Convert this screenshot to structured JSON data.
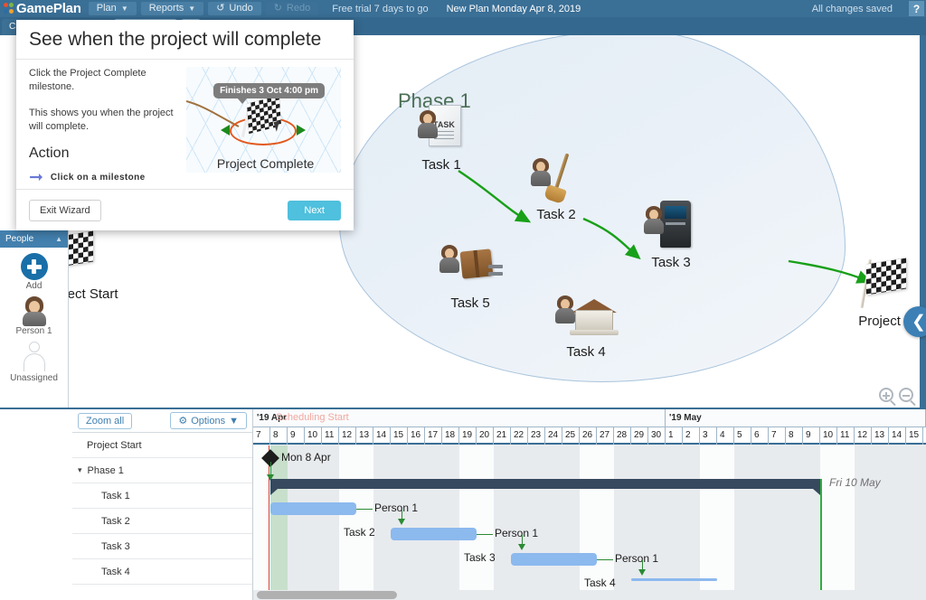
{
  "app": {
    "name": "GamePlan",
    "menus": [
      {
        "label": "Plan",
        "caret": "chevron-down-icon"
      },
      {
        "label": "Reports",
        "caret": "chevron-down-icon"
      }
    ],
    "undo_label": "Undo",
    "redo_label": "Redo",
    "trial_text": "Free trial 7 days to go",
    "plan_title": "New Plan Monday Apr 8, 2019",
    "save_status": "All changes saved",
    "help_label": "?"
  },
  "tabs": [
    {
      "label": "Cr"
    },
    {
      "label": ""
    },
    {
      "label": ""
    }
  ],
  "canvas": {
    "phase_label": "Phase 1",
    "project_start_label": "Project Start",
    "project_end_label": "Project End",
    "nodes": [
      {
        "label": "Task 1",
        "icon": "document-task-icon"
      },
      {
        "label": "Task 2",
        "icon": "broom-icon"
      },
      {
        "label": "Task 3",
        "icon": "kiosk-icon"
      },
      {
        "label": "Task 4",
        "icon": "house-icon"
      },
      {
        "label": "Task 5",
        "icon": "box-pallet-icon"
      }
    ],
    "zoom_in": "zoom-in-icon",
    "zoom_out": "zoom-out-icon",
    "nav_arrow": "chevron-left-icon"
  },
  "people": {
    "header": "People",
    "collapse": "triangle-up-icon",
    "items": [
      {
        "label": "Add",
        "icon": "plus-circle-icon"
      },
      {
        "label": "Person 1",
        "icon": "avatar-icon"
      },
      {
        "label": "Unassigned",
        "icon": "ghost-avatar-icon"
      }
    ]
  },
  "gantt": {
    "zoom_all_label": "Zoom all",
    "options_label": "Options",
    "options_icon": "gear-icon",
    "options_caret": "chevron-down-icon",
    "rows": [
      {
        "label": "Project Start",
        "indent": 0,
        "chevron": ""
      },
      {
        "label": "Phase 1",
        "indent": 0,
        "chevron": "chevron-down-icon"
      },
      {
        "label": "Task 1",
        "indent": 1,
        "chevron": ""
      },
      {
        "label": "Task 2",
        "indent": 1,
        "chevron": ""
      },
      {
        "label": "Task 3",
        "indent": 1,
        "chevron": ""
      },
      {
        "label": "Task 4",
        "indent": 1,
        "chevron": ""
      }
    ],
    "scheduling_start_label": "Scheduling Start",
    "months": [
      {
        "label": "'19  Apr",
        "start_day_index": 0,
        "span": 24
      },
      {
        "label": "'19  May",
        "start_day_index": 24,
        "span": 15
      }
    ],
    "days": [
      "7",
      "8",
      "9",
      "10",
      "11",
      "12",
      "13",
      "14",
      "15",
      "16",
      "17",
      "18",
      "19",
      "20",
      "21",
      "22",
      "23",
      "24",
      "25",
      "26",
      "27",
      "28",
      "29",
      "30",
      "1",
      "2",
      "3",
      "4",
      "5",
      "6",
      "7",
      "8",
      "9",
      "10",
      "11",
      "12",
      "13",
      "14",
      "15"
    ],
    "bars": [
      {
        "row": 0,
        "type": "milestone",
        "label": "Mon 8 Apr",
        "start_day_index": 1,
        "length_days": 0,
        "assignee": ""
      },
      {
        "row": 1,
        "type": "summary",
        "label": "Phase 1",
        "start_day_index": 1,
        "length_days": 32,
        "assignee": ""
      },
      {
        "row": 2,
        "type": "task",
        "label": "Task 1",
        "start_day_index": 1,
        "length_days": 5,
        "assignee": "Person 1"
      },
      {
        "row": 3,
        "type": "task",
        "label": "Task 2",
        "start_day_index": 8,
        "length_days": 5,
        "assignee": "Person 1"
      },
      {
        "row": 4,
        "type": "task",
        "label": "Task 3",
        "start_day_index": 15,
        "length_days": 5,
        "assignee": "Person 1"
      },
      {
        "row": 5,
        "type": "task",
        "label": "Task 4",
        "start_day_index": 22,
        "length_days": 5,
        "assignee": ""
      }
    ],
    "finish_label": "Fri 10 May",
    "finish_day_index": 33
  },
  "wizard": {
    "title": "See when the project will complete",
    "paragraphs": [
      "Click the Project Complete milestone.",
      "This shows you when the project will complete."
    ],
    "action_heading": "Action",
    "action_text": "Click on a milestone",
    "action_arrow": "arrow-right-icon",
    "image": {
      "tooltip": "Finishes 3 Oct 4:00 pm",
      "caption": "Project Complete",
      "flag": "checkered-flag-icon",
      "cursor": "mouse-pointer-icon"
    },
    "exit_label": "Exit Wizard",
    "next_label": "Next"
  },
  "colors": {
    "topbar": "#3a6f96",
    "accent": "#4fc0dd",
    "bar": "#8cb9ee",
    "summary": "#37495e",
    "link": "#2b8a33",
    "today": "#e03b30"
  }
}
